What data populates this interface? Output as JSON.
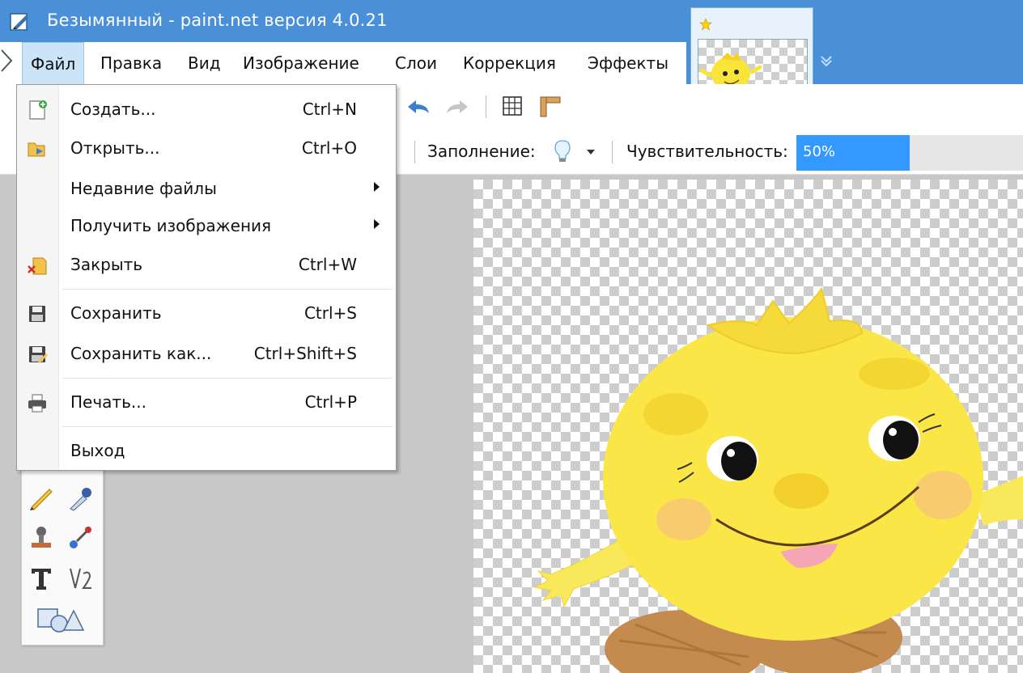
{
  "window": {
    "title": "Безымянный - paint.net версия 4.0.21"
  },
  "menubar": {
    "items": [
      {
        "label": "Файл",
        "active": true
      },
      {
        "label": "Правка"
      },
      {
        "label": "Вид"
      },
      {
        "label": "Изображение"
      },
      {
        "label": "Слои"
      },
      {
        "label": "Коррекция"
      },
      {
        "label": "Эффекты"
      }
    ]
  },
  "file_menu": {
    "items": [
      {
        "label": "Создать...",
        "shortcut": "Ctrl+N",
        "icon": "new-file-icon"
      },
      {
        "label": "Открыть...",
        "shortcut": "Ctrl+O",
        "icon": "open-folder-icon"
      },
      {
        "label": "Недавние файлы",
        "submenu": true
      },
      {
        "label": "Получить изображения",
        "submenu": true
      },
      {
        "label": "Закрыть",
        "shortcut": "Ctrl+W",
        "icon": "close-file-icon"
      },
      {
        "label": "Сохранить",
        "shortcut": "Ctrl+S",
        "icon": "save-icon"
      },
      {
        "label": "Сохранить как...",
        "shortcut": "Ctrl+Shift+S",
        "icon": "save-as-icon"
      },
      {
        "label": "Печать...",
        "shortcut": "Ctrl+P",
        "icon": "print-icon"
      },
      {
        "label": "Выход"
      }
    ]
  },
  "toolbar": {
    "fill_label": "Заполнение:",
    "sensitivity_label": "Чувствительность:",
    "sensitivity_value": "50%",
    "sensitivity_fraction": 0.5
  },
  "colors": {
    "titlebar": "#4a90d9",
    "menu_active": "#cce4f7",
    "accent": "#3399ff"
  }
}
